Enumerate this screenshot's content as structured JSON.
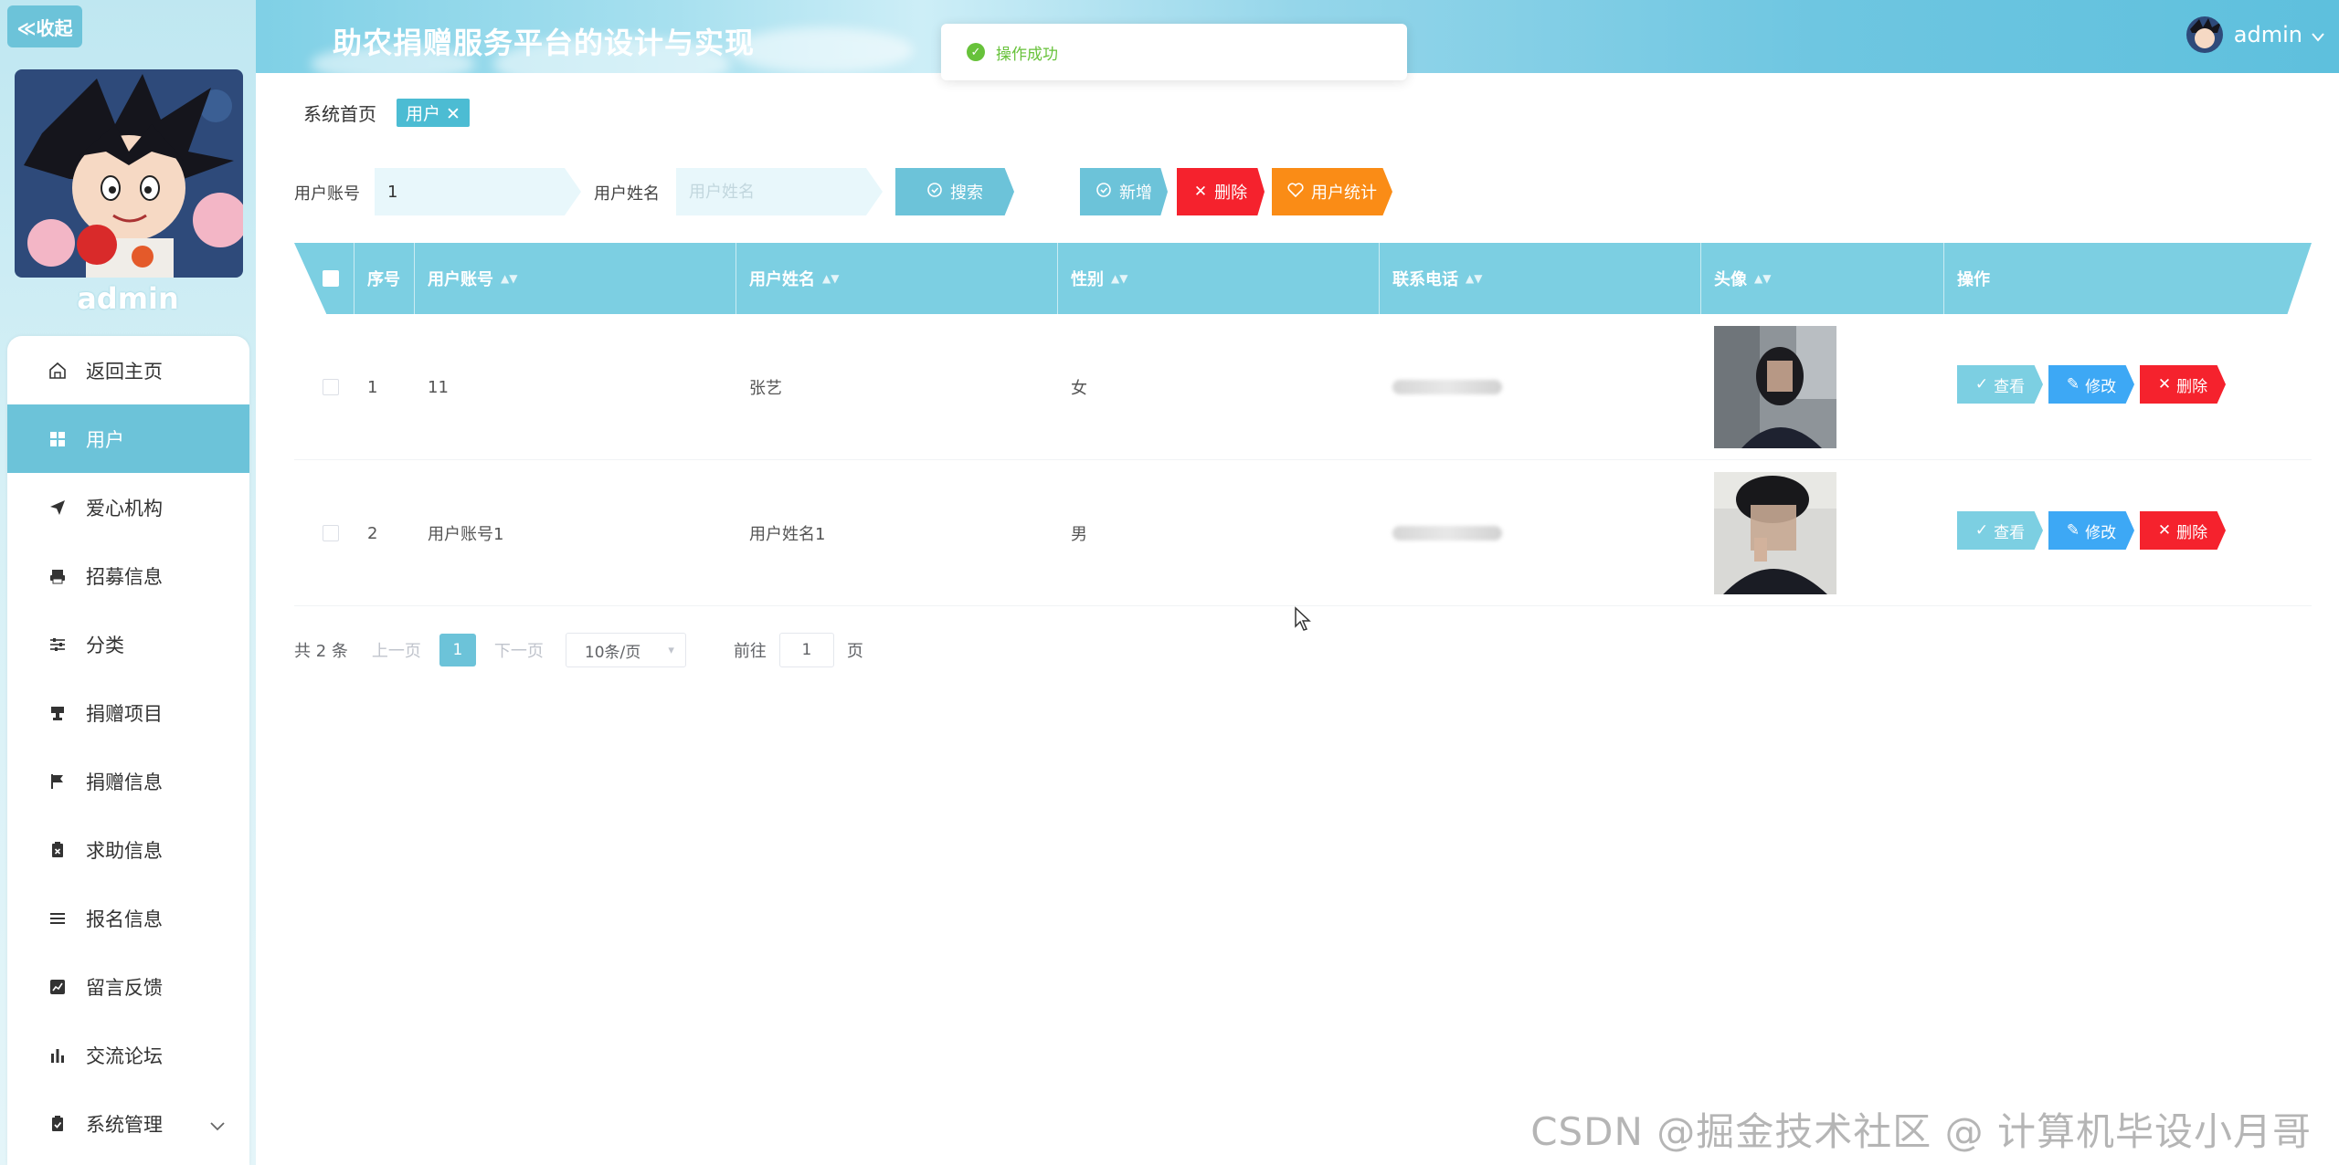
{
  "sidebar": {
    "collapse_label": "≪收起",
    "username": "admin",
    "menu": [
      {
        "label": "返回主页",
        "icon": "home-icon"
      },
      {
        "label": "用户",
        "icon": "grid-icon",
        "active": true
      },
      {
        "label": "爱心机构",
        "icon": "send-icon"
      },
      {
        "label": "招募信息",
        "icon": "printer-icon"
      },
      {
        "label": "分类",
        "icon": "sliders-icon"
      },
      {
        "label": "捐赠项目",
        "icon": "stamp-icon"
      },
      {
        "label": "捐赠信息",
        "icon": "flag-icon"
      },
      {
        "label": "求助信息",
        "icon": "clipboard-x-icon"
      },
      {
        "label": "报名信息",
        "icon": "list-icon"
      },
      {
        "label": "留言反馈",
        "icon": "chart-box-icon"
      },
      {
        "label": "交流论坛",
        "icon": "bar-chart-icon"
      },
      {
        "label": "系统管理",
        "icon": "clipboard-check-icon"
      }
    ]
  },
  "header": {
    "title": "助农捐赠服务平台的设计与实现",
    "user": "admin"
  },
  "toast": {
    "text": "操作成功"
  },
  "breadcrumb": {
    "home": "系统首页",
    "tag": "用户 ✕"
  },
  "search": {
    "account_label": "用户账号",
    "account_value": "1",
    "name_label": "用户姓名",
    "name_placeholder": "用户姓名",
    "search_btn": "搜索",
    "add_btn": "新增",
    "delete_btn": "删除",
    "stats_btn": "用户统计"
  },
  "table": {
    "headers": [
      "序号",
      "用户账号",
      "用户姓名",
      "性别",
      "联系电话",
      "头像",
      "操作"
    ],
    "rows": [
      {
        "index": "1",
        "account": "11",
        "name": "张艺",
        "gender": "女"
      },
      {
        "index": "2",
        "account": "用户账号1",
        "name": "用户姓名1",
        "gender": "男"
      }
    ],
    "actions": {
      "view": "查看",
      "edit": "修改",
      "delete": "删除"
    }
  },
  "pagination": {
    "total": "共 2 条",
    "prev": "上一页",
    "current": "1",
    "next": "下一页",
    "size": "10条/页",
    "goto": "前往",
    "goto_value": "1",
    "page_unit": "页"
  },
  "watermark": "CSDN @掘金技术社区 @ 计算机毕设小月哥",
  "colors": {
    "accent": "#6cc3d9",
    "header_bg": "#7ccfe2",
    "danger": "#f5222d",
    "edit": "#3da8f5",
    "warning": "#fa8c16",
    "success": "#67c23a"
  }
}
